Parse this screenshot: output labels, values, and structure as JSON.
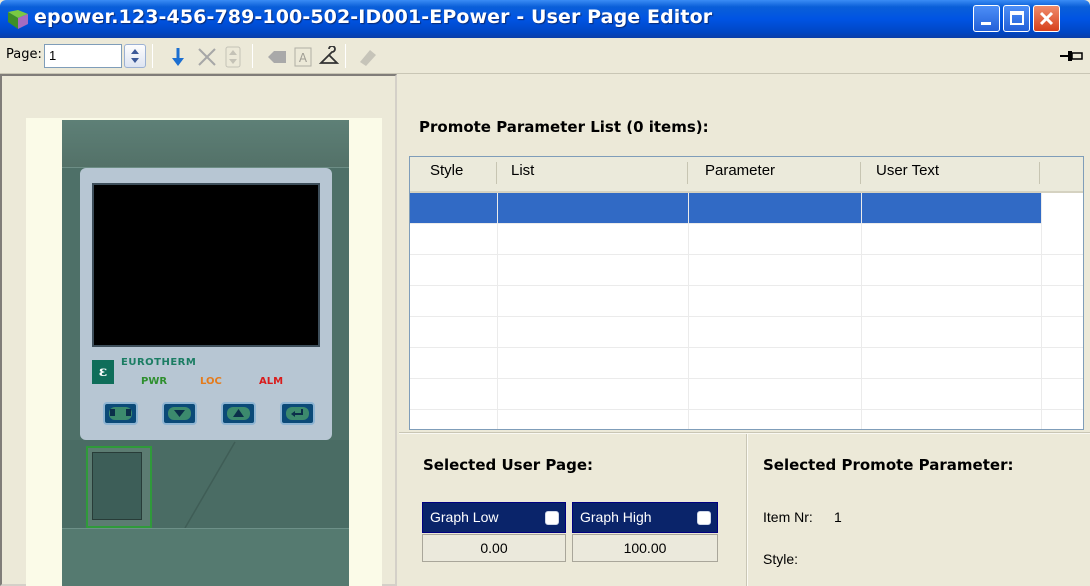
{
  "window": {
    "title": "epower.123-456-789-100-502-ID001-EPower - User Page Editor"
  },
  "toolbar": {
    "page_label": "Page:",
    "page_value": "1"
  },
  "device": {
    "logo_letter": "ε",
    "brand": "EUROTHERM",
    "led_pwr": "PWR",
    "led_loc": "LOC",
    "led_alm": "ALM"
  },
  "promote": {
    "title": "Promote Parameter List (0 items):",
    "columns": [
      "Style",
      "List",
      "Parameter",
      "User Text"
    ],
    "row_count": 8,
    "selected_row": 0
  },
  "selected_user_page": {
    "title": "Selected User Page:",
    "graph_low_label": "Graph Low",
    "graph_low_value": "0.00",
    "graph_high_label": "Graph High",
    "graph_high_value": "100.00"
  },
  "selected_promote_parameter": {
    "title": "Selected Promote Parameter:",
    "item_nr_label": "Item Nr:",
    "item_nr_value": "1",
    "style_label": "Style:"
  },
  "colors": {
    "titlebar": "#0054e3",
    "selection": "#316ac5",
    "chip": "#0a246a"
  }
}
